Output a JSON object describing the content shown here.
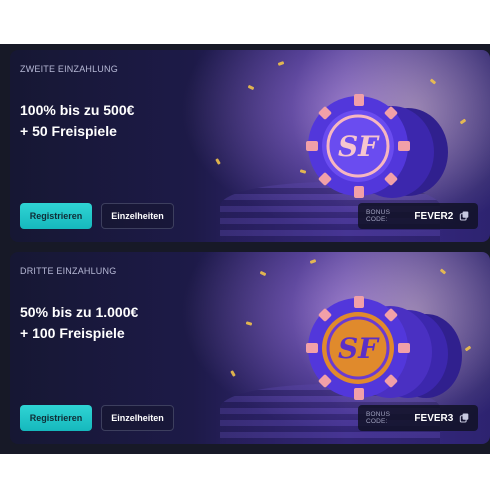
{
  "offers": [
    {
      "tag": "ZWEITE EINZAHLUNG",
      "title_line1": "100% bis zu 500€",
      "title_line2": "+ 50 Freispiele",
      "register_label": "Registrieren",
      "details_label": "Einzelheiten",
      "bonus_code_label": "BONUS CODE:",
      "bonus_code": "FEVER2",
      "chip_logo": "SF",
      "chip_color": "#4b2fcf"
    },
    {
      "tag": "DRITTE EINZAHLUNG",
      "title_line1": "50% bis zu 1.000€",
      "title_line2": "+ 100 Freispiele",
      "register_label": "Registrieren",
      "details_label": "Einzelheiten",
      "bonus_code_label": "BONUS CODE:",
      "bonus_code": "FEVER3",
      "chip_logo": "SF",
      "chip_color": "#e08a2c"
    }
  ],
  "colors": {
    "panel_bg": "#171927",
    "accent_primary": "#22c8cb",
    "text_primary": "#ffffff",
    "text_muted": "#b7b9d6"
  },
  "icons": {
    "copy": "copy-icon"
  }
}
